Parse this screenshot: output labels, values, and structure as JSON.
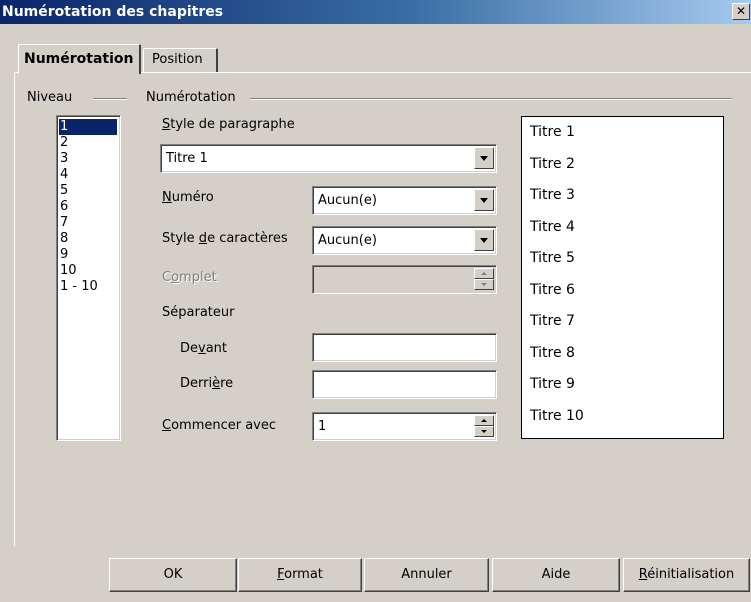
{
  "window": {
    "title": "Numérotation des chapitres",
    "close_glyph": "✕"
  },
  "tabs": [
    {
      "label": "Numérotation",
      "active": true
    },
    {
      "label": "Position",
      "active": false
    }
  ],
  "level_group": {
    "label": "Niveau",
    "items": [
      "1",
      "2",
      "3",
      "4",
      "5",
      "6",
      "7",
      "8",
      "9",
      "10",
      "1 - 10"
    ],
    "selected": "1"
  },
  "numbering_group": {
    "label": "Numérotation",
    "paragraph_style": {
      "label_pre": "",
      "label_mn": "S",
      "label_post": "tyle de paragraphe",
      "value": "Titre 1"
    },
    "number": {
      "label_pre": "",
      "label_mn": "N",
      "label_post": "uméro",
      "value": "Aucun(e)"
    },
    "char_style": {
      "label_pre": "Style ",
      "label_mn": "d",
      "label_post": "e caractères",
      "value": "Aucun(e)"
    },
    "complete": {
      "label_pre": "C",
      "label_mn": "o",
      "label_post": "mplet",
      "value": "",
      "disabled": true
    },
    "separator": {
      "label": "Séparateur",
      "before": {
        "label_pre": "De",
        "label_mn": "v",
        "label_post": "ant",
        "value": ""
      },
      "after": {
        "label_pre": "Derri",
        "label_mn": "è",
        "label_post": "re",
        "value": ""
      }
    },
    "start_at": {
      "label_pre": "",
      "label_mn": "C",
      "label_post": "ommencer avec",
      "value": "1"
    }
  },
  "preview": [
    "Titre 1",
    "Titre 2",
    "Titre 3",
    "Titre 4",
    "Titre 5",
    "Titre 6",
    "Titre 7",
    "Titre 8",
    "Titre 9",
    "Titre 10"
  ],
  "buttons": {
    "ok": {
      "pre": "OK",
      "mn": "",
      "post": ""
    },
    "format": {
      "pre": "",
      "mn": "F",
      "post": "ormat"
    },
    "cancel": {
      "pre": "Annuler",
      "mn": "",
      "post": ""
    },
    "help": {
      "pre": "Aide",
      "mn": "",
      "post": ""
    },
    "reset": {
      "pre": "",
      "mn": "R",
      "post": "éinitialisation"
    }
  }
}
